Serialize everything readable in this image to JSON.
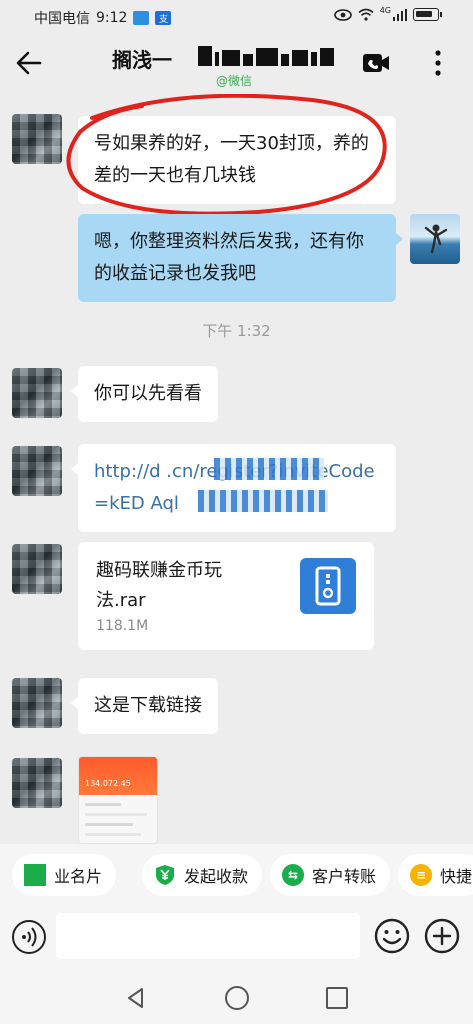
{
  "status_bar": {
    "carrier": "中国电信",
    "time": "9:12",
    "app_icon_label": "支",
    "network": "4G"
  },
  "header": {
    "title": "搁浅一",
    "subtitle": "@微信"
  },
  "messages": [
    {
      "side": "left",
      "text": "号如果养的好，一天30封顶，养的差的一天也有几块钱"
    },
    {
      "side": "right",
      "text": "嗯，你整理资料然后发我，还有你的收益记录也发我吧"
    },
    {
      "type": "time",
      "text": "下午 1:32"
    },
    {
      "side": "left",
      "text": "你可以先看看"
    },
    {
      "side": "left",
      "type": "link",
      "text": "http://d          .cn/register?inviteCode=kED        Aql"
    },
    {
      "side": "left",
      "type": "file",
      "name": "趣码联赚金币玩法.rar",
      "size": "118.1M"
    },
    {
      "side": "left",
      "text": "这是下载链接"
    },
    {
      "side": "left",
      "type": "image",
      "amount": "134,072.45"
    }
  ],
  "quick_actions": [
    {
      "label": "业名片",
      "icon": "business-card-icon",
      "color": "#1aad4a"
    },
    {
      "label": "发起收款",
      "icon": "yuan-icon",
      "color": "#1aad4a"
    },
    {
      "label": "客户转账",
      "icon": "transfer-icon",
      "color": "#1aad4a"
    },
    {
      "label": "快捷",
      "icon": "quick-reply-icon",
      "color": "#f5b400"
    }
  ],
  "input": {
    "placeholder": ""
  },
  "colors": {
    "self_bubble": "#a9d8f5",
    "annotation_red": "#e0231c",
    "link": "#3a6fa8",
    "wechat_green": "#39a955"
  }
}
